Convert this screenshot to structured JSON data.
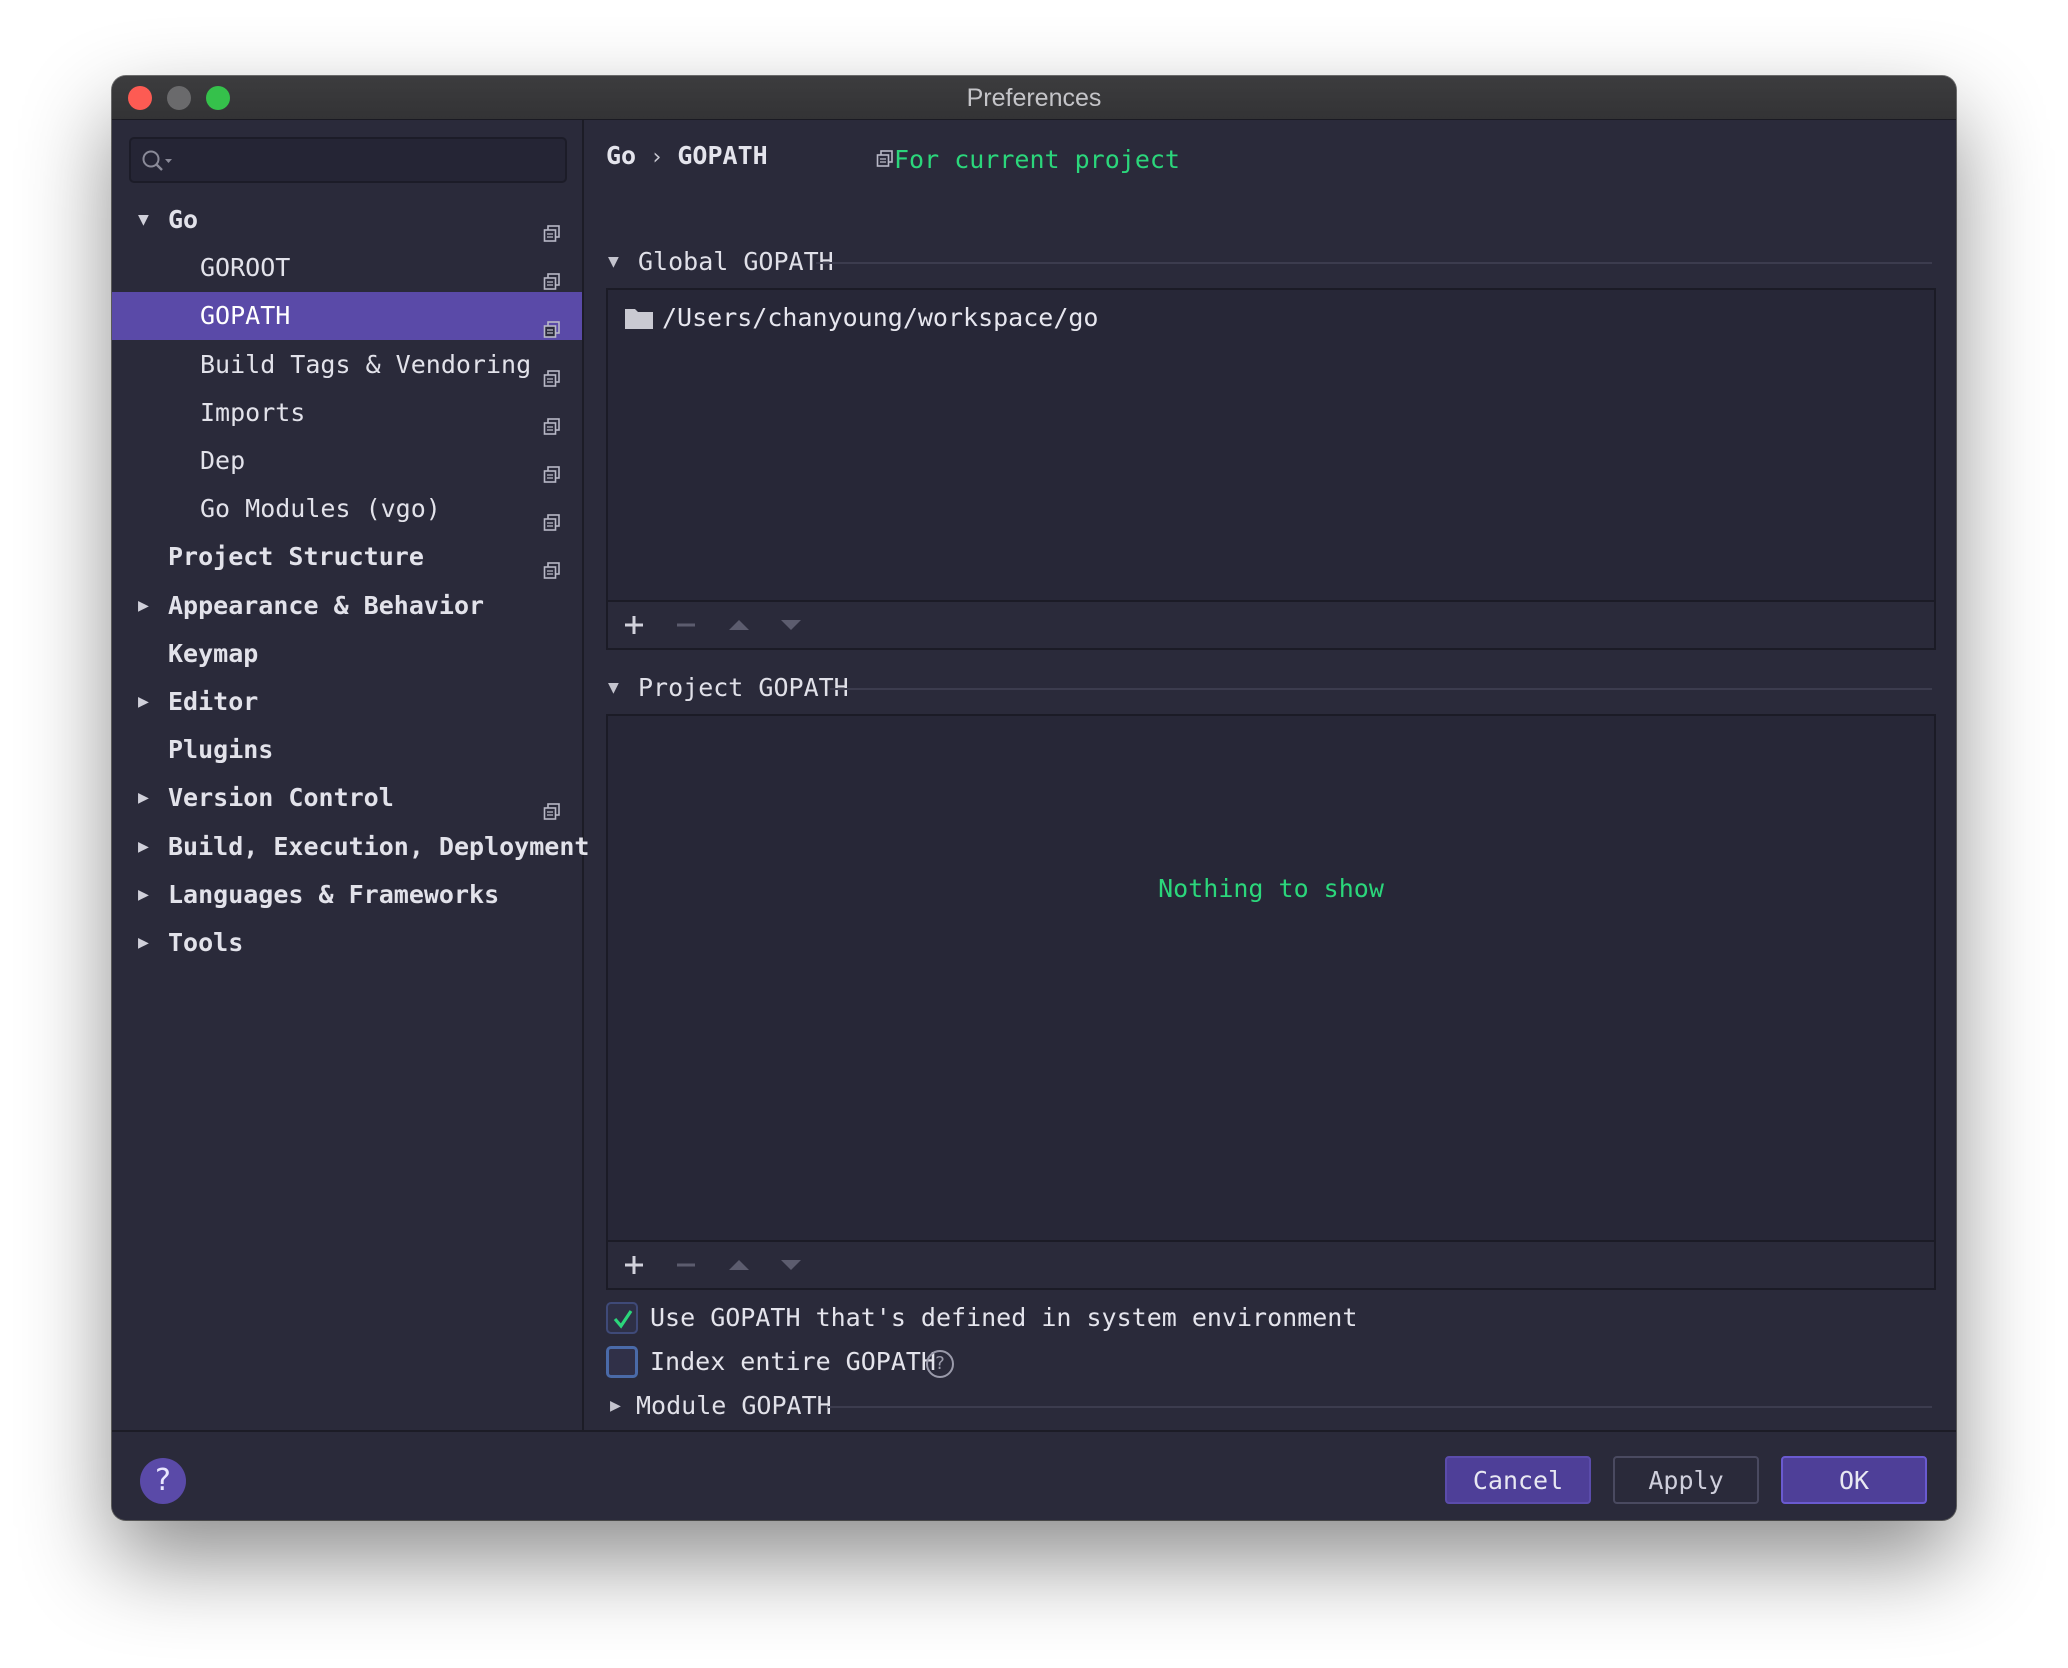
{
  "window": {
    "title": "Preferences"
  },
  "search": {
    "placeholder": "",
    "value": ""
  },
  "sidebar": {
    "items": [
      {
        "label": "Go",
        "expanded": true,
        "project_scoped": true
      },
      {
        "label": "GOROOT",
        "project_scoped": true
      },
      {
        "label": "GOPATH",
        "selected": true,
        "project_scoped": true
      },
      {
        "label": "Build Tags & Vendoring",
        "project_scoped": true
      },
      {
        "label": "Imports",
        "project_scoped": true
      },
      {
        "label": "Dep",
        "project_scoped": true
      },
      {
        "label": "Go Modules (vgo)",
        "project_scoped": true
      },
      {
        "label": "Project Structure",
        "project_scoped": true
      },
      {
        "label": "Appearance & Behavior",
        "expanded": false
      },
      {
        "label": "Keymap"
      },
      {
        "label": "Editor",
        "expanded": false
      },
      {
        "label": "Plugins"
      },
      {
        "label": "Version Control",
        "expanded": false,
        "project_scoped": true
      },
      {
        "label": "Build, Execution, Deployment",
        "expanded": false
      },
      {
        "label": "Languages & Frameworks",
        "expanded": false
      },
      {
        "label": "Tools",
        "expanded": false
      }
    ]
  },
  "breadcrumb": {
    "parent": "Go",
    "separator": "›",
    "current": "GOPATH"
  },
  "scope": {
    "label": "For current project"
  },
  "global_gopath": {
    "header": "Global GOPATH",
    "paths": [
      "/Users/chanyoung/workspace/go"
    ]
  },
  "project_gopath": {
    "header": "Project GOPATH",
    "empty_text": "Nothing to show"
  },
  "options": {
    "use_system_gopath": {
      "label": "Use GOPATH that's defined in system environment",
      "checked": true
    },
    "index_entire_gopath": {
      "label": "Index entire GOPATH",
      "checked": false,
      "help": "?"
    }
  },
  "module_gopath": {
    "header": "Module GOPATH",
    "expanded": false
  },
  "footer": {
    "help": "?",
    "cancel": "Cancel",
    "apply": "Apply",
    "ok": "OK"
  },
  "colors": {
    "accent": "#5a4aa8",
    "highlight_text": "#2bd67b",
    "background": "#2a2a3a"
  }
}
